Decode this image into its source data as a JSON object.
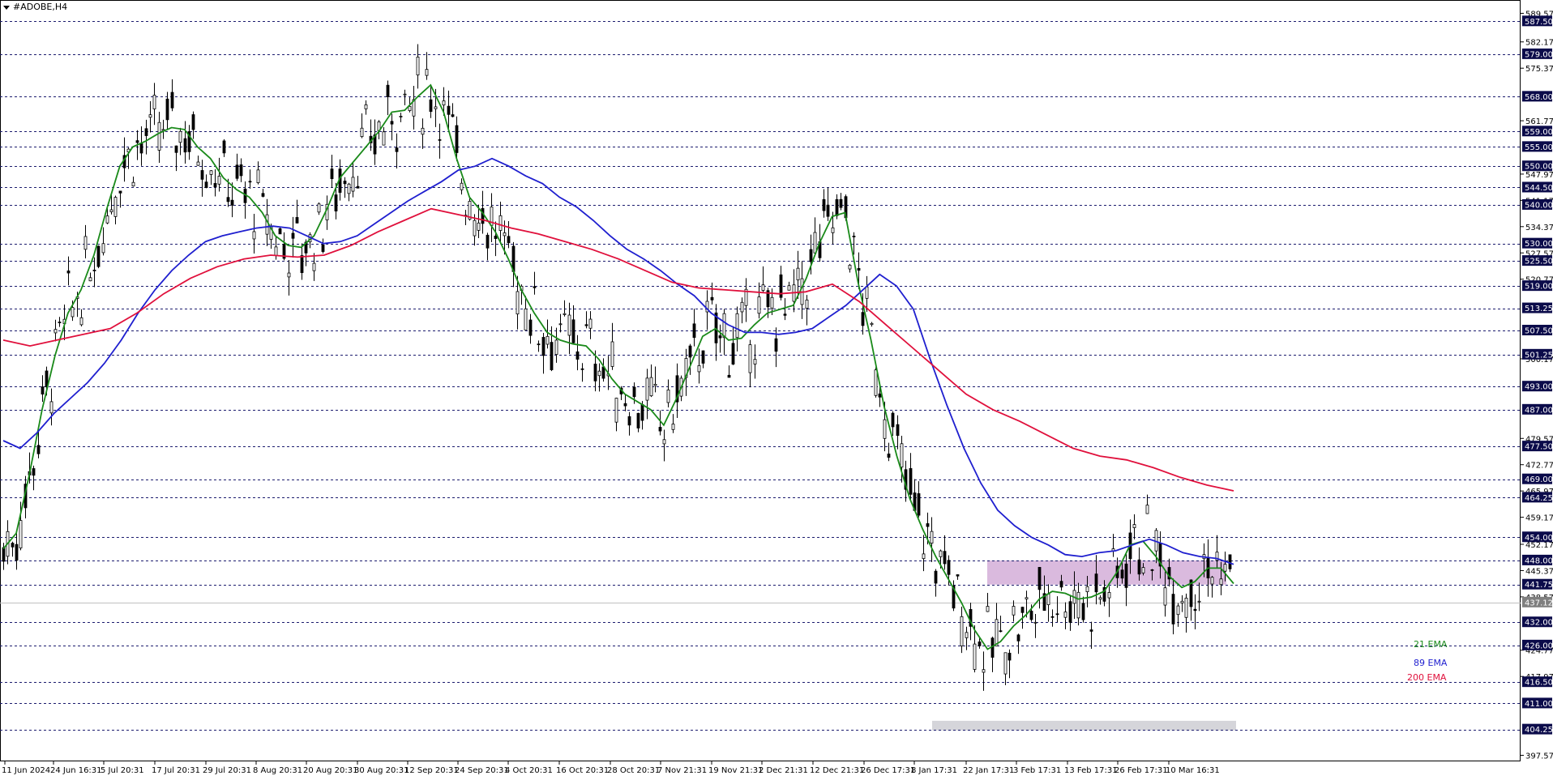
{
  "title": "#ADOBE,H4",
  "legend": [
    {
      "label": "21 EMA",
      "color": "#1a8a1a"
    },
    {
      "label": "89 EMA",
      "color": "#1f1fcf"
    },
    {
      "label": "200 EMA",
      "color": "#e0103c"
    }
  ],
  "colors": {
    "grid": "#1c1c6e",
    "price_line": "#c0c0c0",
    "level_bg": "#0b0b4a",
    "ema21": "#1a8a1a",
    "ema89": "#1f1fcf",
    "ema200": "#e0103c",
    "zone_upper": "#d6b3da",
    "zone_lower": "#d0d0d6"
  },
  "chart_data": {
    "type": "candlestick",
    "symbol": "#ADOBE",
    "timeframe": "H4",
    "ylim": [
      396.0,
      590.5
    ],
    "x_labels": [
      "11 Jun 2024",
      "24 Jun 16:31",
      "5 Jul 20:31",
      "17 Jul 20:31",
      "29 Jul 20:31",
      "8 Aug 20:31",
      "20 Aug 20:31",
      "30 Aug 20:31",
      "12 Sep 20:31",
      "24 Sep 20:31",
      "4 Oct 20:31",
      "16 Oct 20:31",
      "28 Oct 20:31",
      "7 Nov 21:31",
      "19 Nov 21:31",
      "2 Dec 21:31",
      "12 Dec 21:31",
      "26 Dec 17:31",
      "8 Jan 17:31",
      "22 Jan 17:31",
      "3 Feb 17:31",
      "13 Feb 17:31",
      "26 Feb 17:31",
      "10 Mar 16:31"
    ],
    "y_ticks": [
      "589.57",
      "582.17",
      "575.37",
      "561.77",
      "547.97",
      "541.17",
      "534.37",
      "527.57",
      "520.77",
      "500.17",
      "479.57",
      "472.77",
      "465.97",
      "459.17",
      "452.17",
      "445.37",
      "438.57",
      "424.77",
      "417.97",
      "397.57"
    ],
    "levels": [
      "587.50",
      "579.00",
      "568.00",
      "559.00",
      "555.00",
      "550.00",
      "544.50",
      "540.00",
      "530.00",
      "525.50",
      "519.00",
      "513.25",
      "507.50",
      "501.25",
      "493.00",
      "487.00",
      "477.50",
      "469.00",
      "464.25",
      "454.00",
      "448.00",
      "441.75",
      "432.00",
      "426.00",
      "416.50",
      "411.00",
      "404.25"
    ],
    "current_price": "437.12",
    "zones": [
      {
        "name": "resistance-zone",
        "top": 448.0,
        "bottom": 441.75,
        "from": "16 Jan",
        "to": "13 Mar"
      },
      {
        "name": "support-zone",
        "top": 406.5,
        "bottom": 404.0,
        "from": "6 Jan",
        "to": "13 Mar"
      }
    ],
    "ema_lines": [
      {
        "name": "21 EMA",
        "points": [
          [
            0,
            451.0
          ],
          [
            1,
            455.0
          ],
          [
            2,
            470.0
          ],
          [
            3,
            487.0
          ],
          [
            4,
            501.0
          ],
          [
            5,
            512.0
          ],
          [
            6,
            518.0
          ],
          [
            7,
            527.0
          ],
          [
            8,
            539.0
          ],
          [
            9,
            550.0
          ],
          [
            10,
            555.0
          ],
          [
            11,
            556.5
          ],
          [
            12,
            558.5
          ],
          [
            13,
            560.0
          ],
          [
            14,
            559.5
          ],
          [
            15,
            555.0
          ],
          [
            16,
            552.0
          ],
          [
            17,
            547.0
          ],
          [
            18,
            544.0
          ],
          [
            19,
            542.0
          ],
          [
            20,
            538.0
          ],
          [
            21,
            532.0
          ],
          [
            22,
            529.5
          ],
          [
            23,
            529.0
          ],
          [
            24,
            532.0
          ],
          [
            25,
            539.0
          ],
          [
            26,
            547.0
          ],
          [
            27,
            551.0
          ],
          [
            28,
            555.0
          ],
          [
            29,
            559.0
          ],
          [
            30,
            564.0
          ],
          [
            31,
            564.5
          ],
          [
            32,
            568.0
          ],
          [
            33,
            571.0
          ],
          [
            34,
            564.0
          ],
          [
            35,
            552.0
          ],
          [
            36,
            542.0
          ],
          [
            37,
            538.0
          ],
          [
            38,
            533.0
          ],
          [
            39,
            526.0
          ],
          [
            40,
            518.0
          ],
          [
            41,
            512.0
          ],
          [
            42,
            507.0
          ],
          [
            43,
            505.0
          ],
          [
            44,
            504.0
          ],
          [
            45,
            503.5
          ],
          [
            46,
            500.0
          ],
          [
            47,
            495.0
          ],
          [
            48,
            491.0
          ],
          [
            49,
            489.0
          ],
          [
            50,
            487.0
          ],
          [
            51,
            483.0
          ],
          [
            52,
            490.0
          ],
          [
            53,
            498.0
          ],
          [
            54,
            506.0
          ],
          [
            55,
            508.0
          ],
          [
            56,
            505.0
          ],
          [
            57,
            505.5
          ],
          [
            58,
            509.0
          ],
          [
            59,
            512.0
          ],
          [
            60,
            513.0
          ],
          [
            61,
            514.0
          ],
          [
            62,
            521.0
          ],
          [
            63,
            530.0
          ],
          [
            64,
            537.0
          ],
          [
            65,
            538.0
          ],
          [
            66,
            520.0
          ],
          [
            67,
            505.0
          ],
          [
            68,
            488.0
          ],
          [
            69,
            475.0
          ],
          [
            70,
            464.0
          ],
          [
            71,
            456.0
          ],
          [
            72,
            449.0
          ],
          [
            73,
            443.0
          ],
          [
            74,
            437.0
          ],
          [
            75,
            430.0
          ],
          [
            76,
            425.0
          ],
          [
            77,
            427.0
          ],
          [
            78,
            431.0
          ],
          [
            79,
            434.0
          ],
          [
            80,
            438.0
          ],
          [
            81,
            440.0
          ],
          [
            82,
            439.5
          ],
          [
            83,
            438.0
          ],
          [
            84,
            438.5
          ],
          [
            85,
            440.0
          ],
          [
            86,
            445.0
          ],
          [
            87,
            452.0
          ],
          [
            88,
            453.0
          ],
          [
            89,
            449.0
          ],
          [
            90,
            444.0
          ],
          [
            91,
            441.0
          ],
          [
            92,
            442.5
          ],
          [
            93,
            446.0
          ],
          [
            94,
            446.0
          ],
          [
            95,
            442.0
          ]
        ]
      },
      {
        "name": "89 EMA",
        "points": [
          [
            0,
            479.0
          ],
          [
            1,
            477.0
          ],
          [
            2,
            481.0
          ],
          [
            3,
            486.0
          ],
          [
            4,
            490.0
          ],
          [
            5,
            494.0
          ],
          [
            6,
            499.0
          ],
          [
            7,
            505.0
          ],
          [
            8,
            512.0
          ],
          [
            9,
            518.0
          ],
          [
            10,
            523.0
          ],
          [
            11,
            527.0
          ],
          [
            12,
            530.5
          ],
          [
            13,
            532.0
          ],
          [
            14,
            533.0
          ],
          [
            15,
            534.0
          ],
          [
            16,
            534.5
          ],
          [
            17,
            534.0
          ],
          [
            18,
            532.0
          ],
          [
            19,
            530.0
          ],
          [
            20,
            530.5
          ],
          [
            21,
            532.0
          ],
          [
            22,
            535.0
          ],
          [
            23,
            538.0
          ],
          [
            24,
            541.0
          ],
          [
            25,
            543.5
          ],
          [
            26,
            546.0
          ],
          [
            27,
            549.0
          ],
          [
            28,
            550.0
          ],
          [
            29,
            552.0
          ],
          [
            30,
            550.0
          ],
          [
            31,
            547.5
          ],
          [
            32,
            545.5
          ],
          [
            33,
            542.0
          ],
          [
            34,
            539.5
          ],
          [
            35,
            536.0
          ],
          [
            36,
            532.0
          ],
          [
            37,
            528.5
          ],
          [
            38,
            526.0
          ],
          [
            39,
            523.0
          ],
          [
            40,
            519.5
          ],
          [
            41,
            516.5
          ],
          [
            42,
            512.0
          ],
          [
            43,
            509.0
          ],
          [
            44,
            507.0
          ],
          [
            45,
            507.0
          ],
          [
            46,
            506.5
          ],
          [
            47,
            507.0
          ],
          [
            48,
            508.0
          ],
          [
            49,
            511.0
          ],
          [
            50,
            514.0
          ],
          [
            51,
            518.0
          ],
          [
            52,
            522.0
          ],
          [
            53,
            519.0
          ],
          [
            54,
            513.0
          ],
          [
            55,
            500.0
          ],
          [
            56,
            488.0
          ],
          [
            57,
            477.0
          ],
          [
            58,
            468.0
          ],
          [
            59,
            461.0
          ],
          [
            60,
            457.0
          ],
          [
            61,
            454.0
          ],
          [
            62,
            452.0
          ],
          [
            63,
            449.5
          ],
          [
            64,
            449.0
          ],
          [
            65,
            450.0
          ],
          [
            66,
            450.5
          ],
          [
            67,
            452.0
          ],
          [
            68,
            453.5
          ],
          [
            69,
            452.0
          ],
          [
            70,
            450.0
          ],
          [
            71,
            449.0
          ],
          [
            72,
            448.5
          ],
          [
            73,
            447.0
          ]
        ]
      },
      {
        "name": "200 EMA",
        "points": [
          [
            0,
            505.0
          ],
          [
            1,
            503.5
          ],
          [
            2,
            505.0
          ],
          [
            3,
            506.5
          ],
          [
            4,
            508.0
          ],
          [
            5,
            512.0
          ],
          [
            6,
            517.0
          ],
          [
            7,
            521.0
          ],
          [
            8,
            524.0
          ],
          [
            9,
            526.0
          ],
          [
            10,
            527.0
          ],
          [
            11,
            526.5
          ],
          [
            12,
            527.0
          ],
          [
            13,
            529.5
          ],
          [
            14,
            533.0
          ],
          [
            15,
            536.0
          ],
          [
            16,
            539.0
          ],
          [
            17,
            537.5
          ],
          [
            18,
            536.0
          ],
          [
            19,
            534.0
          ],
          [
            20,
            532.5
          ],
          [
            21,
            530.5
          ],
          [
            22,
            528.5
          ],
          [
            23,
            526.0
          ],
          [
            24,
            523.0
          ],
          [
            25,
            520.0
          ],
          [
            26,
            518.5
          ],
          [
            27,
            518.0
          ],
          [
            28,
            517.5
          ],
          [
            29,
            517.0
          ],
          [
            30,
            517.5
          ],
          [
            31,
            519.5
          ],
          [
            32,
            515.0
          ],
          [
            33,
            509.0
          ],
          [
            34,
            503.0
          ],
          [
            35,
            497.0
          ],
          [
            36,
            491.0
          ],
          [
            37,
            487.0
          ],
          [
            38,
            484.0
          ],
          [
            39,
            480.5
          ],
          [
            40,
            477.0
          ],
          [
            41,
            475.0
          ],
          [
            42,
            474.0
          ],
          [
            43,
            472.0
          ],
          [
            44,
            469.5
          ],
          [
            45,
            467.5
          ],
          [
            46,
            466.0
          ]
        ]
      }
    ]
  }
}
